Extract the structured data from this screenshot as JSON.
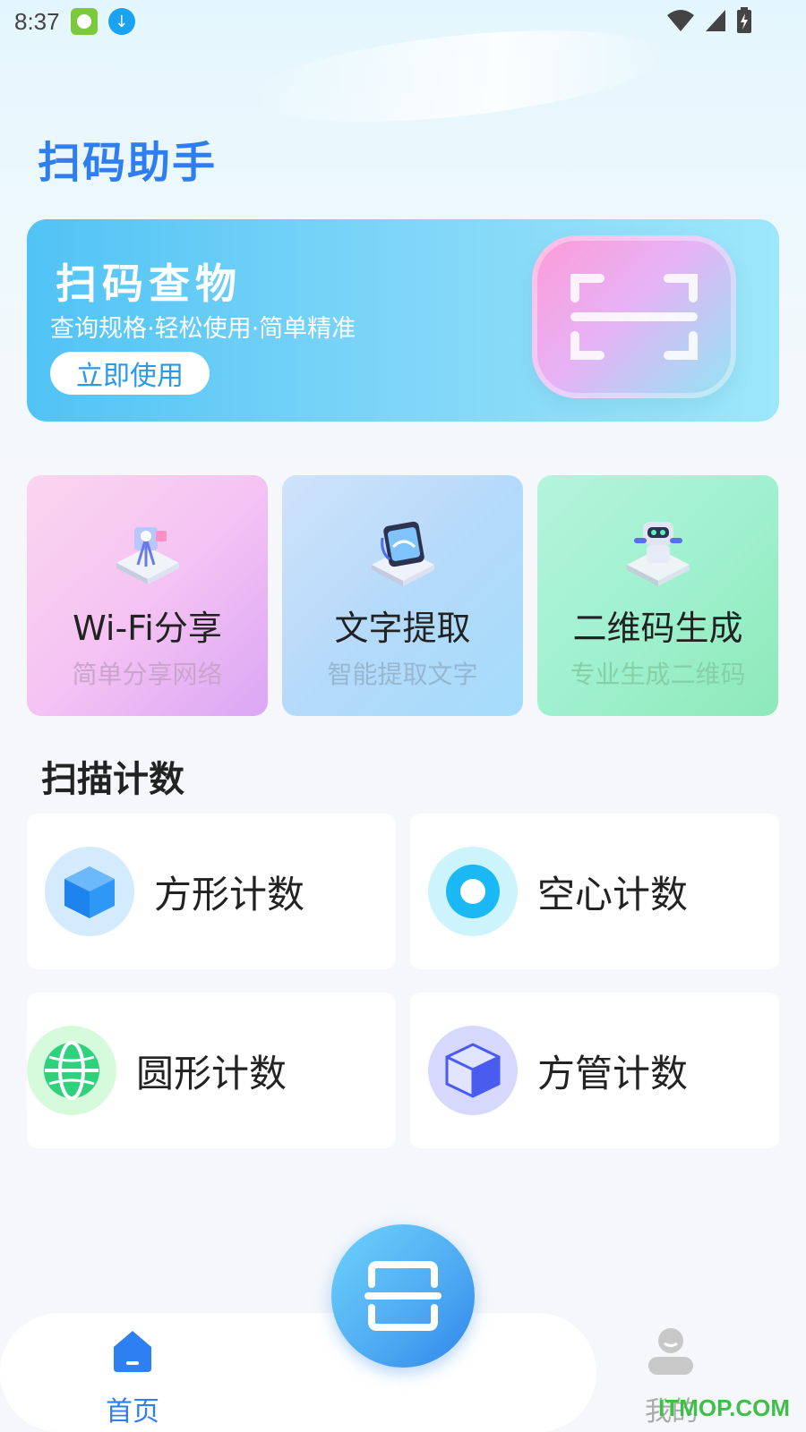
{
  "status_bar": {
    "time": "8:37"
  },
  "app": {
    "title": "扫码助手"
  },
  "banner": {
    "title": "扫码查物",
    "subtitle": "查询规格·轻松使用·简单精准",
    "button_label": "立即使用"
  },
  "features": [
    {
      "label": "Wi-Fi分享",
      "desc": "简单分享网络"
    },
    {
      "label": "文字提取",
      "desc": "智能提取文字"
    },
    {
      "label": "二维码生成",
      "desc": "专业生成二维码"
    }
  ],
  "section": {
    "title": "扫描计数"
  },
  "counters": [
    {
      "label": "方形计数",
      "icon": "cube-icon",
      "color": "#2f8ff0"
    },
    {
      "label": "空心计数",
      "icon": "ring-icon",
      "color": "#1ab8f5"
    },
    {
      "label": "圆形计数",
      "icon": "globe-icon",
      "color": "#2fd17c"
    },
    {
      "label": "方管计数",
      "icon": "box-outline-icon",
      "color": "#4a5cf0"
    }
  ],
  "nav": {
    "home_label": "首页",
    "mine_label": "我的"
  },
  "colors": {
    "accent": "#2f7ef0",
    "banner": "#50c3f5"
  },
  "watermark": "ITMOP.COM"
}
